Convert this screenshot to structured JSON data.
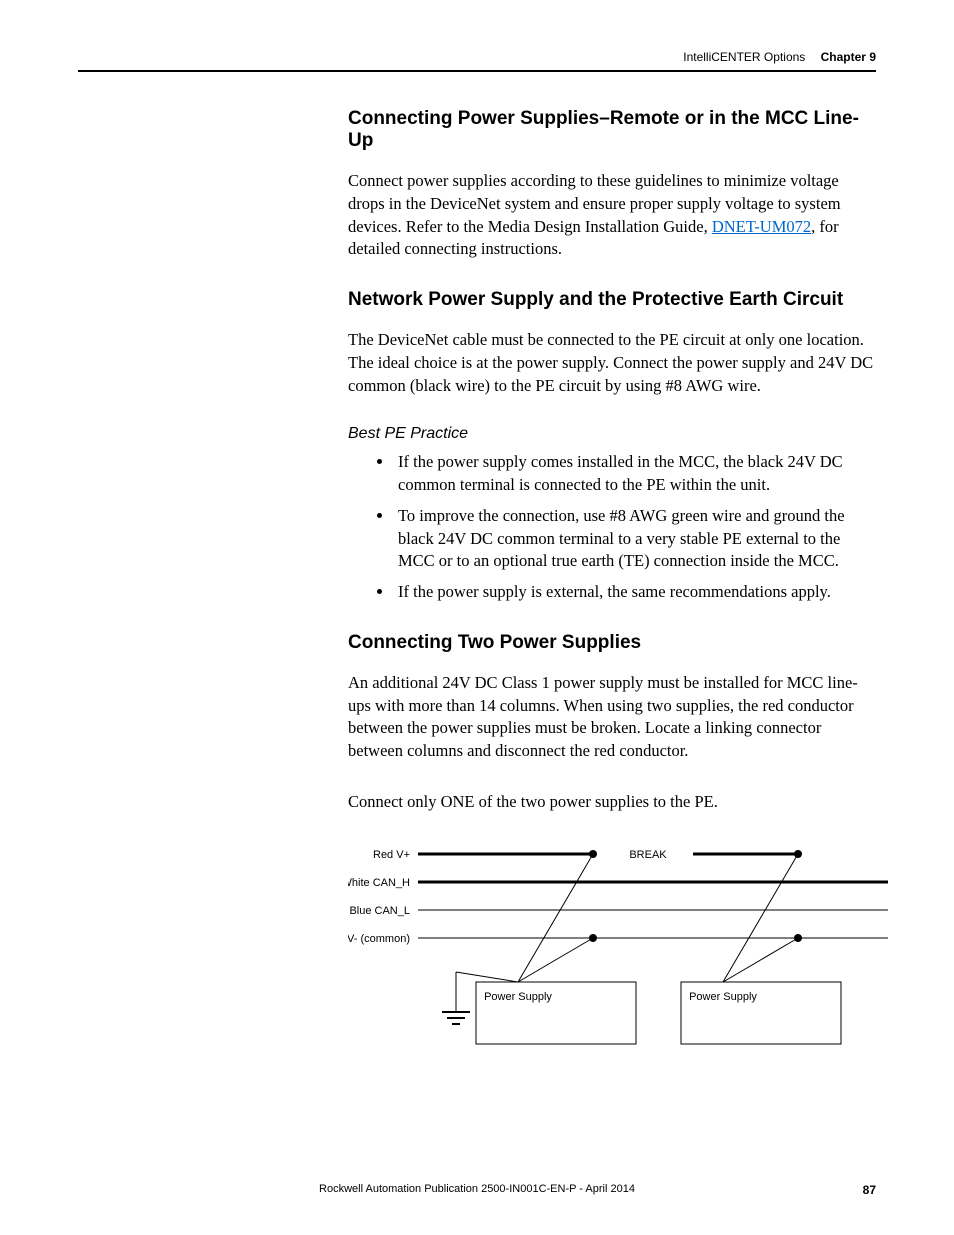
{
  "header": {
    "section": "IntelliCENTER Options",
    "chapter": "Chapter 9"
  },
  "s1": {
    "heading": "Connecting Power Supplies–Remote or in the MCC Line-Up",
    "p1a": "Connect power supplies according to these guidelines to minimize voltage drops in the DeviceNet system and ensure proper supply voltage to system devices. Refer to the Media Design Installation Guide, ",
    "link": "DNET-UM072",
    "p1b": ", for detailed connecting instructions."
  },
  "s2": {
    "heading": "Network Power Supply and the Protective Earth Circuit",
    "p1": "The DeviceNet cable must be connected to the PE circuit at only one location. The ideal choice is at the power supply. Connect the power supply and 24V DC common (black wire) to the PE circuit by using #8 AWG wire.",
    "sub": "Best PE Practice",
    "b1": "If the power supply comes installed in the MCC, the black 24V DC common terminal is connected to the PE within the unit.",
    "b2": "To improve the connection, use #8 AWG green wire and ground the black 24V DC common terminal to a very stable PE external to the MCC or to an optional true earth (TE) connection inside the MCC.",
    "b3": "If the power supply is external, the same recommendations apply."
  },
  "s3": {
    "heading": "Connecting Two Power Supplies",
    "p1": "An additional 24V DC Class 1 power supply must be installed for MCC line-ups with more than 14 columns. When using two supplies, the red conductor between the power supplies must be broken. Locate a linking connector between columns and disconnect the red conductor.",
    "p2": "Connect only ONE of the two power supplies to the PE."
  },
  "diagram": {
    "red": "Red V+",
    "white": "White CAN_H",
    "blue": "Blue CAN_L",
    "black": "Black V- (common)",
    "break": "BREAK",
    "ps": "Power Supply"
  },
  "footer": {
    "pub": "Rockwell Automation Publication 2500-IN001C-EN-P - April 2014",
    "page": "87"
  }
}
